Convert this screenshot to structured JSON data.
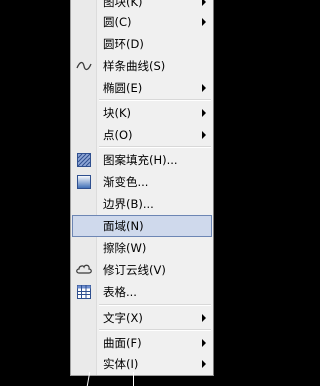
{
  "menu": {
    "items": [
      {
        "label": "图块(K)",
        "submenu": true
      },
      {
        "label": "圆(C)",
        "submenu": true
      },
      {
        "label": "圆环(D)",
        "submenu": false
      },
      {
        "label": "样条曲线(S)",
        "submenu": false,
        "icon": "spline-icon"
      },
      {
        "label": "椭圆(E)",
        "submenu": true
      },
      {
        "label": "块(K)",
        "submenu": true
      },
      {
        "label": "点(O)",
        "submenu": true
      },
      {
        "label": "图案填充(H)...",
        "submenu": false,
        "icon": "hatch-icon"
      },
      {
        "label": "渐变色...",
        "submenu": false,
        "icon": "gradient-icon"
      },
      {
        "label": "边界(B)...",
        "submenu": false
      },
      {
        "label": "面域(N)",
        "submenu": false,
        "highlighted": true
      },
      {
        "label": "擦除(W)",
        "submenu": false
      },
      {
        "label": "修订云线(V)",
        "submenu": false,
        "icon": "revcloud-icon"
      },
      {
        "label": "表格...",
        "submenu": false,
        "icon": "table-icon"
      },
      {
        "label": "文字(X)",
        "submenu": true
      },
      {
        "label": "曲面(F)",
        "submenu": true
      },
      {
        "label": "实体(I)",
        "submenu": true
      }
    ]
  },
  "colors": {
    "highlight_bg": "#cfd9ec",
    "highlight_border": "#6d86b4",
    "menu_bg": "#f0f0f0"
  }
}
